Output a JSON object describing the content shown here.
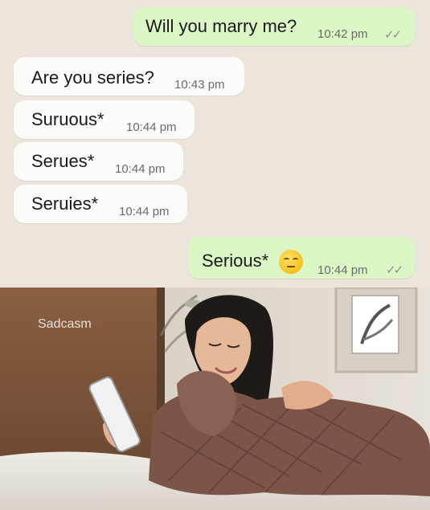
{
  "messages": [
    {
      "dir": "out",
      "text": "Will you marry me?",
      "time": "10:42 pm",
      "ticks": "✓✓"
    },
    {
      "dir": "in",
      "text": "Are you series?",
      "time": "10:43 pm"
    },
    {
      "dir": "in",
      "text": "Suruous*",
      "time": "10:44 pm"
    },
    {
      "dir": "in",
      "text": "Serues*",
      "time": "10:44 pm"
    },
    {
      "dir": "in",
      "text": "Seruies*",
      "time": "10:44 pm"
    },
    {
      "dir": "out",
      "text": "Serious*",
      "time": "10:44 pm",
      "ticks": "✓✓",
      "emoji": "unamused-face"
    }
  ],
  "photo": {
    "watermark": "Sadcasm",
    "description_icon": "woman-with-phone-photo"
  },
  "colors": {
    "chat_background": "#ebe5db",
    "outgoing_bubble": "#dcf6c6",
    "incoming_bubble": "#fbfbf9"
  }
}
